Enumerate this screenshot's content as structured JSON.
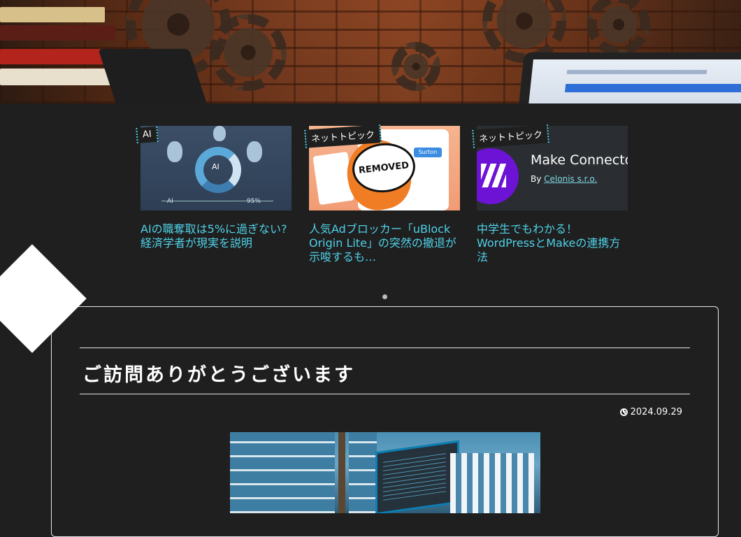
{
  "slider": {
    "cards": [
      {
        "category": "AI",
        "title": "AIの職奪取は5%に過ぎない? 経済学者が現実を説明",
        "thumb_labels": {
          "ai": "AI",
          "percent": "95%",
          "left": "AI"
        }
      },
      {
        "category": "ネットトピック",
        "title": "人気Adブロッカー「uBlock Origin Lite」の突然の撤退が示唆するも…",
        "thumb_labels": {
          "badge": "REMOVED",
          "button": "Surton"
        }
      },
      {
        "category": "ネットトピック",
        "title": "中学生でもわかる！WordPressとMakeの連携方法",
        "thumb_labels": {
          "name": "Make Connecto",
          "by": "By",
          "by_link": "Celonis s.r.o."
        }
      }
    ],
    "active_dot": 1
  },
  "article": {
    "title": "ご訪問ありがとうございます",
    "date": "2024.09.29"
  },
  "colors": {
    "background": "#1f1f1f",
    "accent": "#4fd1e8",
    "border": "#e6e6e6"
  },
  "icons": {
    "date": "clock-icon"
  }
}
